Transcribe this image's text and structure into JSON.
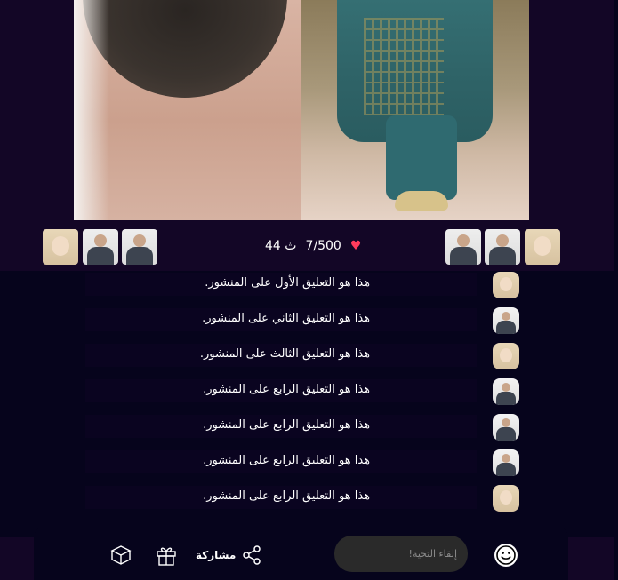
{
  "post": {
    "likes_text": "7/500",
    "comments_count_text": "ث 44"
  },
  "avatars_left": [
    "baby-avatar",
    "suit-avatar",
    "suit-avatar"
  ],
  "avatars_right": [
    "suit-avatar",
    "suit-avatar",
    "baby-avatar"
  ],
  "comments": [
    {
      "text": "هذا هو التعليق الأول على المنشور.",
      "avatar": "baby"
    },
    {
      "text": "هذا هو التعليق الثاني على المنشور.",
      "avatar": "suit"
    },
    {
      "text": "هذا هو التعليق الثالث على المنشور.",
      "avatar": "baby"
    },
    {
      "text": "هذا هو التعليق الرابع على المنشور.",
      "avatar": "suit"
    },
    {
      "text": "هذا هو التعليق الرابع على المنشور.",
      "avatar": "suit"
    },
    {
      "text": "هذا هو التعليق الرابع على المنشور.",
      "avatar": "suit"
    },
    {
      "text": "هذا هو التعليق الرابع على المنشور.",
      "avatar": "baby"
    }
  ],
  "bottom_bar": {
    "share_label": "مشاركة",
    "input_placeholder": "إلقاء التحية!"
  },
  "colors": {
    "background": "#06041c",
    "top_area": "#130626",
    "heart": "#ff3b5c"
  }
}
